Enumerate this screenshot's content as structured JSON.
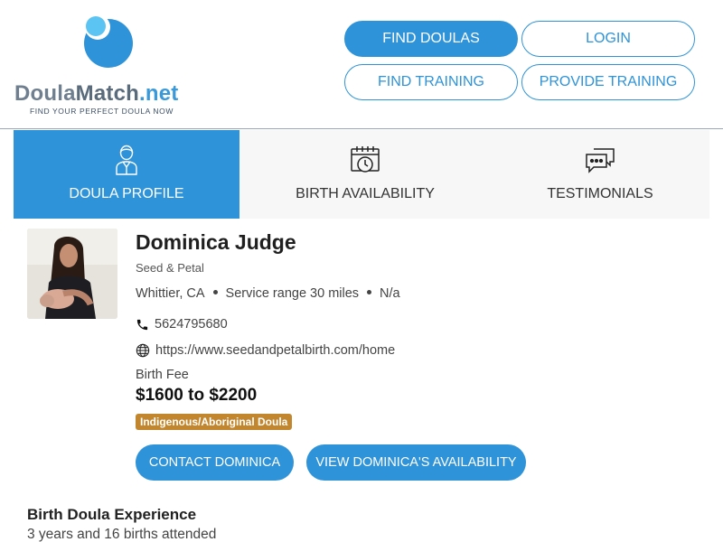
{
  "header": {
    "logo": {
      "part1": "Doula",
      "part2": "Match",
      "part3": ".net",
      "tagline": "FIND YOUR PERFECT DOULA NOW"
    },
    "nav": {
      "find_doulas": "FIND DOULAS",
      "login": "LOGIN",
      "find_training": "FIND TRAINING",
      "provide_training": "PROVIDE TRAINING"
    }
  },
  "tabs": [
    {
      "label": "DOULA PROFILE",
      "icon": "doula-person-icon",
      "active": true
    },
    {
      "label": "BIRTH AVAILABILITY",
      "icon": "calendar-clock-icon",
      "active": false
    },
    {
      "label": "TESTIMONIALS",
      "icon": "chat-bubbles-icon",
      "active": false
    }
  ],
  "profile": {
    "name": "Dominica Judge",
    "agency": "Seed & Petal",
    "location": "Whittier, CA",
    "service_range": "Service range 30 miles",
    "extra": "N/a",
    "phone": "5624795680",
    "website": "https://www.seedandpetalbirth.com/home",
    "fee_label": "Birth Fee",
    "fee_value": "$1600 to $2200",
    "badge": "Indigenous/Aboriginal Doula",
    "contact_button": "CONTACT DOMINICA",
    "availability_button": "VIEW DOMINICA'S AVAILABILITY"
  },
  "experience": {
    "title": "Birth Doula Experience",
    "text": "3 years and 16 births attended"
  },
  "colors": {
    "brand_blue": "#2e93d8",
    "badge": "#c2862f",
    "tab_bg": "#f7f7f7"
  }
}
